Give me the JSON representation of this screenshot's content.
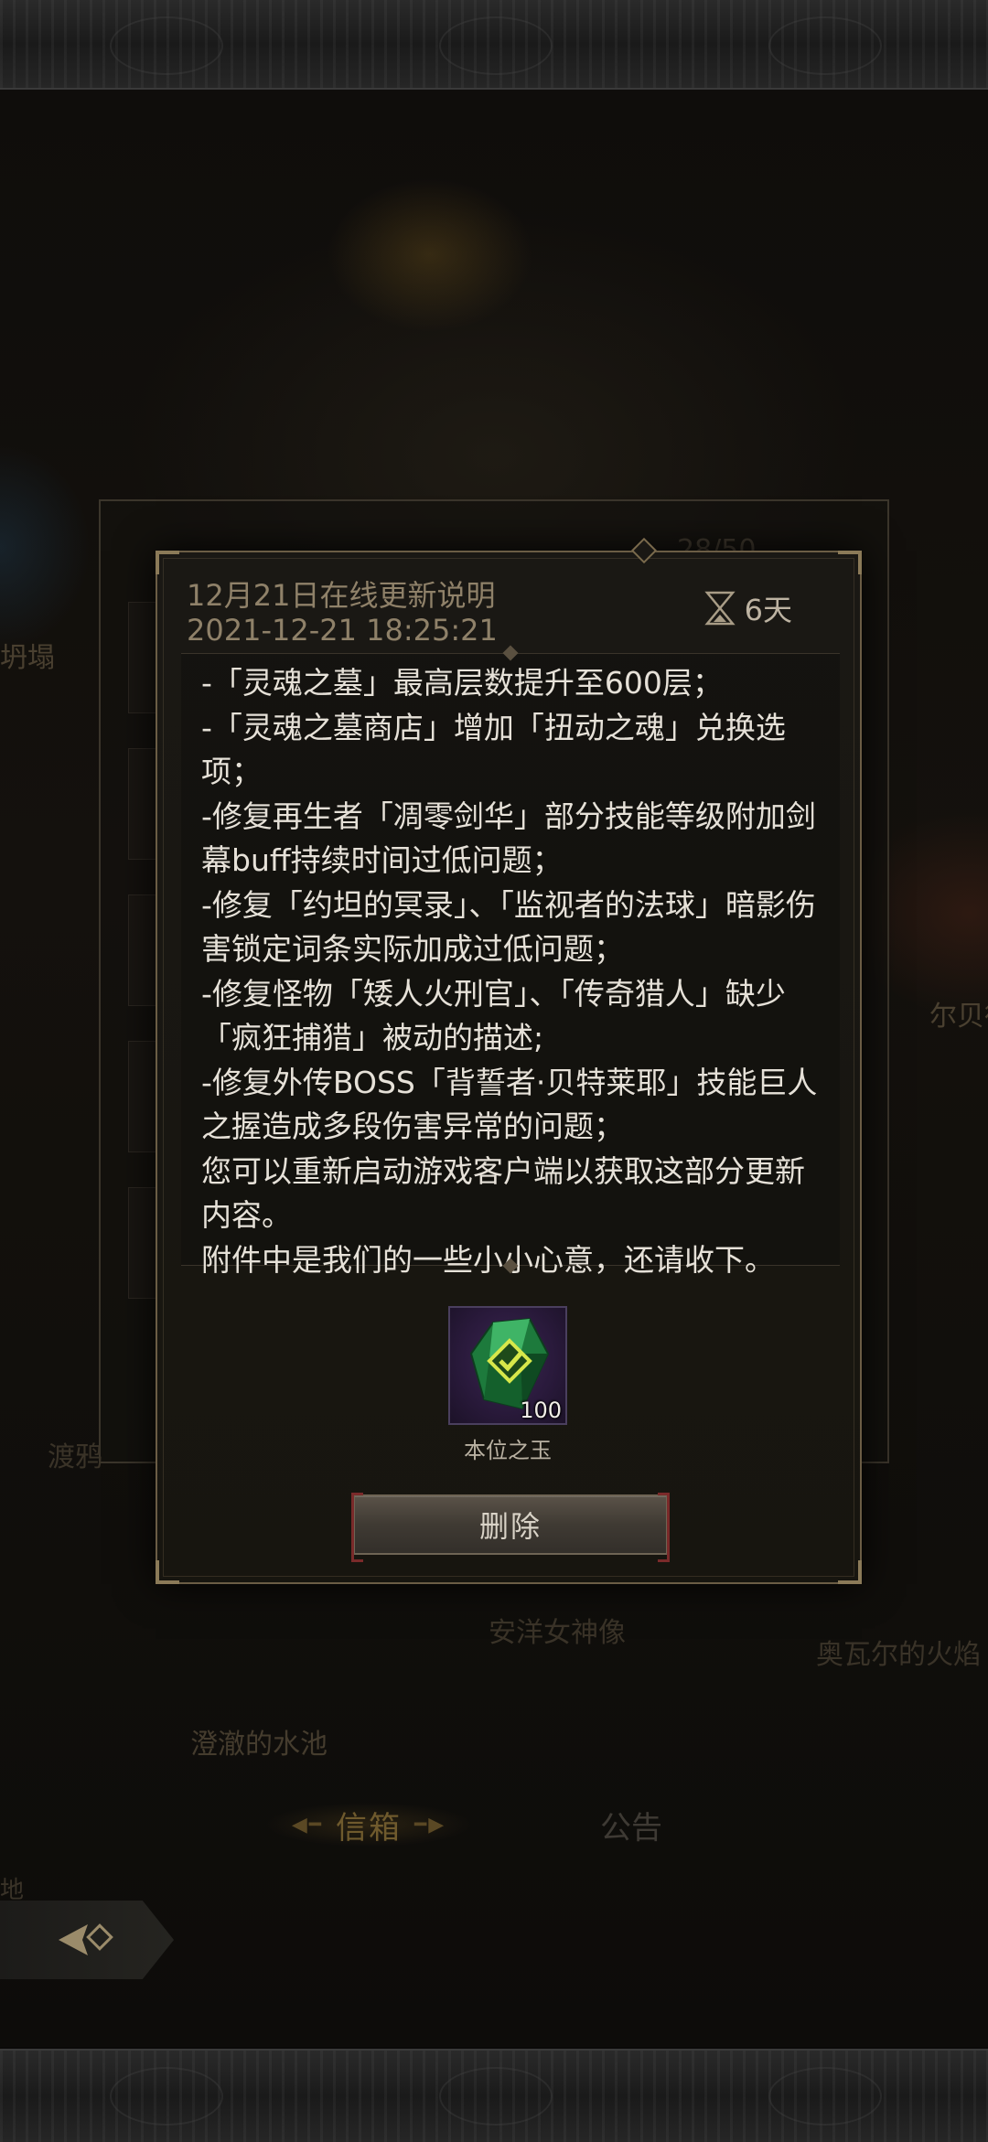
{
  "background": {
    "labels": {
      "collapse": "坍塌",
      "crow": "渡鸦",
      "albert": "尔贝德",
      "goddess_statue": "安洋女神像",
      "fire": "奥瓦尔的火焰",
      "pool": "澄澈的水池",
      "land": "地",
      "counter": "28/50"
    },
    "tabs": {
      "mailbox": "信箱",
      "notice": "公告"
    }
  },
  "mail": {
    "title": "12月21日在线更新说明",
    "datetime": "2021-12-21 18:25:21",
    "expire_icon": "hourglass-icon",
    "expire_text": "6天",
    "body_lines": [
      "-「灵魂之墓」最高层数提升至600层；",
      "-「灵魂之墓商店」增加「扭动之魂」兑换选项；",
      "-修复再生者「凋零剑华」部分技能等级附加剑幕buff持续时间过低问题；",
      "-修复「约坦的冥录」、「监视者的法球」暗影伤害锁定词条实际加成过低问题；",
      "-修复怪物「矮人火刑官」、「传奇猎人」缺少「疯狂捕猎」被动的描述;",
      "-修复外传BOSS「背誓者·贝特莱耶」技能巨人之握造成多段伤害异常的问题；",
      "您可以重新启动游戏客户端以获取这部分更新内容。",
      "附件中是我们的一些小小心意，还请收下。"
    ],
    "attachment": {
      "icon": "green-gem-icon",
      "count": "100",
      "name": "本位之玉"
    },
    "delete_label": "删除"
  }
}
